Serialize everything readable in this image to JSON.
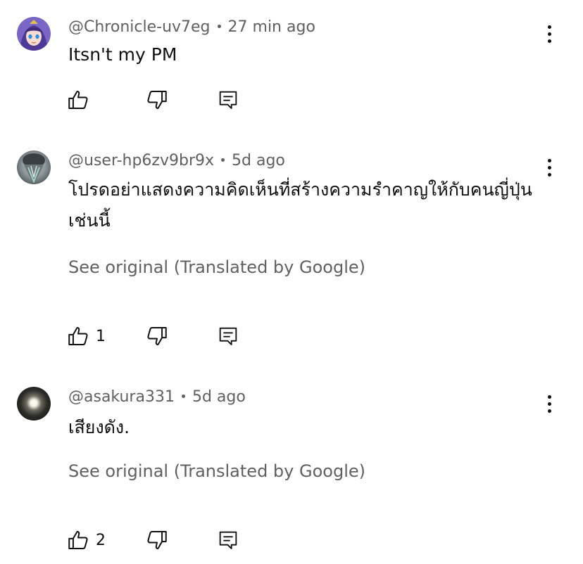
{
  "comments": [
    {
      "author": "@Chronicle-uv7eg",
      "time": "27 min ago",
      "text": "Itsn't my PM",
      "translate_link": "",
      "likes": "",
      "avatar": "anime-avatar"
    },
    {
      "author": "@user-hp6zv9br9x",
      "time": "5d ago",
      "text": "โปรดอย่าแสดงความคิดเห็นที่สร้างความรำคาญให้กับคนญี่ปุ่นเช่นนี้",
      "translate_link": "See original (Translated by Google)",
      "likes": "1",
      "avatar": "photo-avatar"
    },
    {
      "author": "@asakura331",
      "time": "5d ago",
      "text": "เสียงดัง.",
      "translate_link": "See original (Translated by Google)",
      "likes": "2",
      "avatar": "dark-light-avatar"
    }
  ],
  "icons": {
    "like": "thumbs-up-icon",
    "dislike": "thumbs-down-icon",
    "reply": "reply-icon",
    "more": "more-vertical-icon"
  },
  "colors": {
    "text": "#0f0f0f",
    "meta": "#606060",
    "background": "#ffffff"
  }
}
